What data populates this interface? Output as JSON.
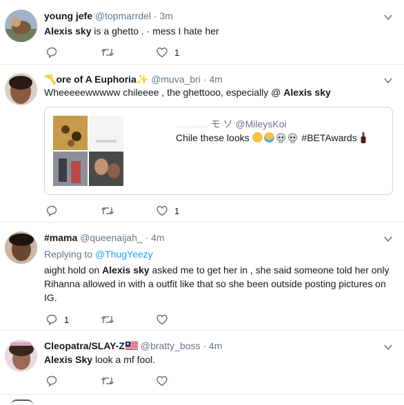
{
  "tweets": [
    {
      "name": "young jefe",
      "handle": "@topmarrdel",
      "dot": "·",
      "time": "3m",
      "text_bold": "Alexis sky",
      "text_rest": " is a ghetto .  ·  mess I hate her",
      "like_count": "1"
    },
    {
      "name_prefix": "〽️",
      "name": "ore of A Euphoria",
      "name_suffix": "✨",
      "handle": "@muva_bri",
      "dot": "·",
      "time": "4m",
      "text_rest": "Wheeeeewwwww chileeee , the ghettooo, especially @ ",
      "text_bold": "Alexis sky",
      "like_count": "1",
      "quote": {
        "name_blurred": "............ ",
        "name_suffix": "モ ソ",
        "handle": "@MileysKoi",
        "text": "Chile these looks",
        "hashtag": "#BETAwards"
      }
    },
    {
      "name": "#mama",
      "handle": "@queenaijah_",
      "dot": "·",
      "time": "4m",
      "reply_label": "Replying to",
      "reply_handle": "@ThugYeezy",
      "text_pre": "aight hold on ",
      "text_bold": "Alexis sky",
      "text_line1_rest": " asked me to get her in , she said someone told her only",
      "text_line2": "Rihanna allowed in with a outfit like that so she been outside posting pictures on",
      "text_line3": "IG.",
      "reply_count": "1"
    },
    {
      "name": "Cleopatra/SLAY-Z",
      "handle": "@bratty_boss",
      "dot": "·",
      "time": "4m",
      "text_bold": "Alexis Sky",
      "text_rest": " look a mf fool."
    }
  ],
  "colors": {
    "link": "#1da1f2",
    "muted": "#657786",
    "border": "#e6ecf0"
  }
}
